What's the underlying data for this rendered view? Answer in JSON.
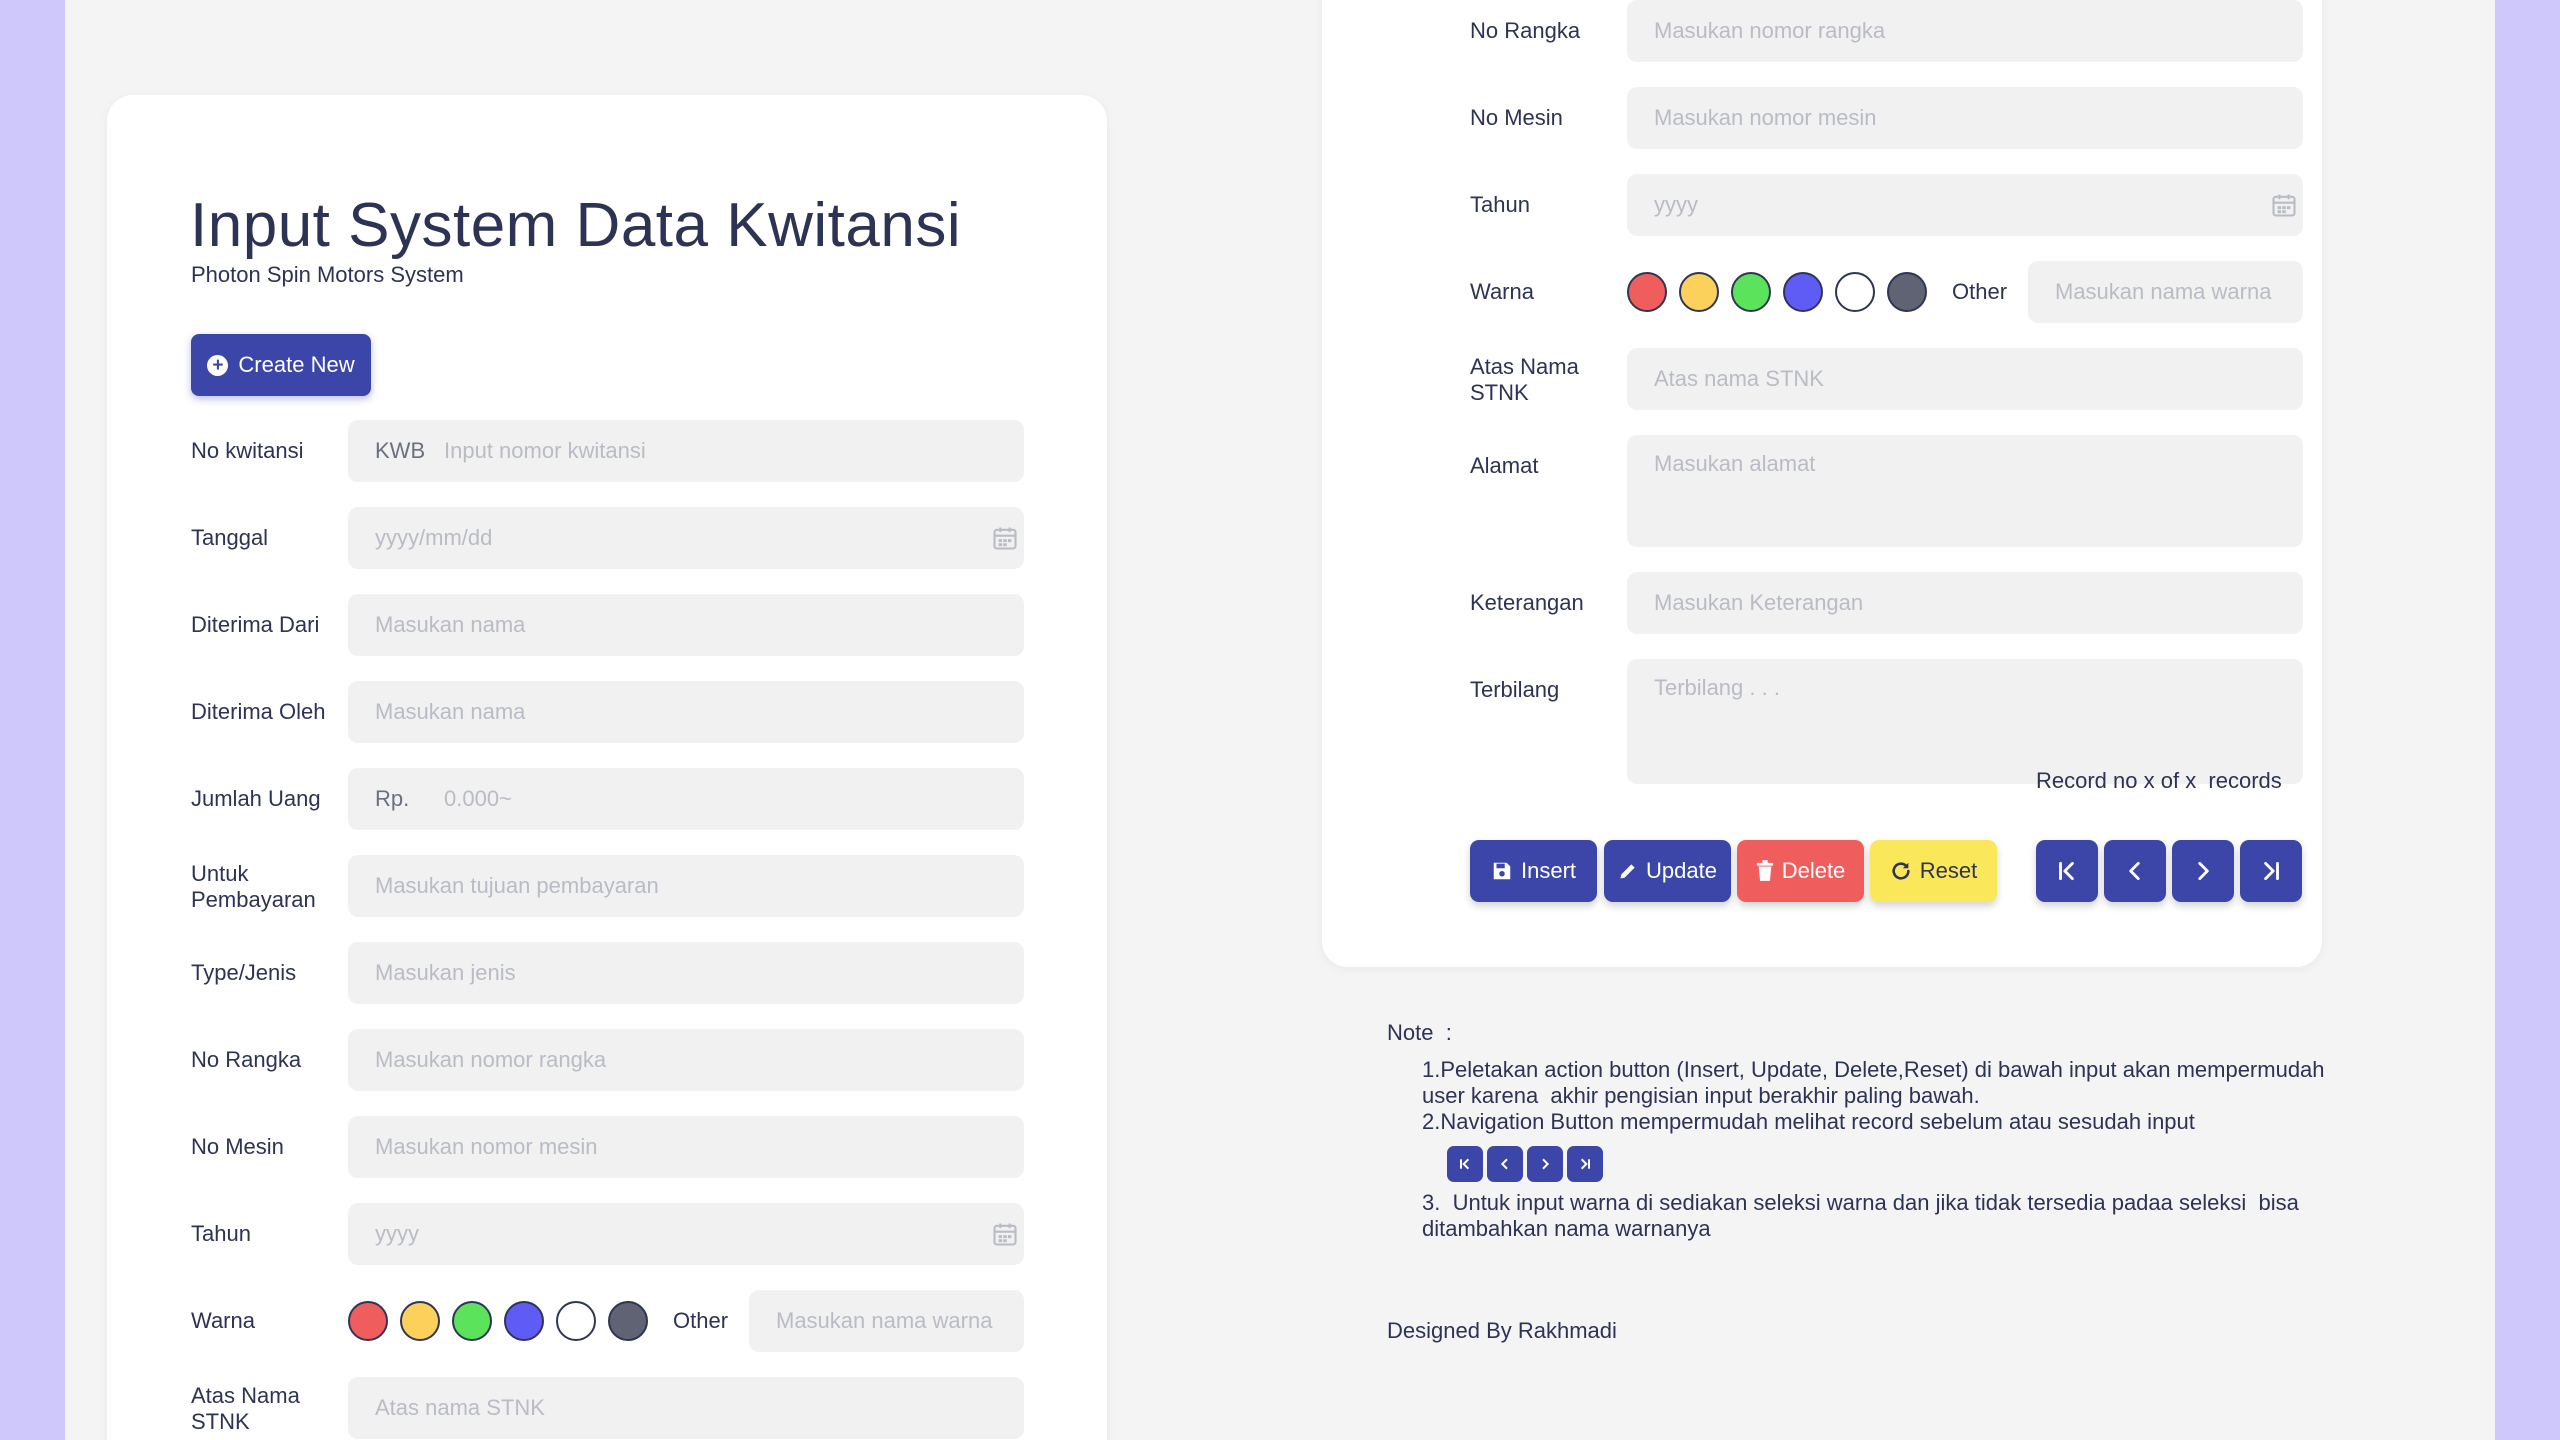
{
  "header": {
    "title": "Input System Data Kwitansi",
    "subtitle": "Photon Spin Motors System",
    "create_label": "Create New"
  },
  "left_form": {
    "no_kwitansi": {
      "label": "No kwitansi",
      "prefix": "KWB",
      "placeholder": "Input nomor kwitansi"
    },
    "tanggal": {
      "label": "Tanggal",
      "placeholder": "yyyy/mm/dd"
    },
    "diterima_dari": {
      "label": "Diterima Dari",
      "placeholder": "Masukan nama"
    },
    "diterima_oleh": {
      "label": "Diterima Oleh",
      "placeholder": "Masukan nama"
    },
    "jumlah_uang": {
      "label": "Jumlah Uang",
      "prefix": "Rp.",
      "placeholder": "0.000~"
    },
    "untuk_pembayaran": {
      "label": "Untuk\nPembayaran",
      "placeholder": "Masukan tujuan pembayaran"
    },
    "type_jenis": {
      "label": "Type/Jenis",
      "placeholder": "Masukan jenis"
    },
    "no_rangka": {
      "label": "No Rangka",
      "placeholder": "Masukan nomor rangka"
    },
    "no_mesin": {
      "label": "No Mesin",
      "placeholder": "Masukan nomor mesin"
    },
    "tahun": {
      "label": "Tahun",
      "placeholder": "yyyy"
    },
    "warna": {
      "label": "Warna",
      "other_label": "Other",
      "placeholder": "Masukan nama warna"
    },
    "atas_nama": {
      "label": "Atas Nama\nSTNK",
      "placeholder": "Atas nama STNK"
    }
  },
  "right_form": {
    "no_rangka": {
      "label": "No Rangka",
      "placeholder": "Masukan nomor rangka"
    },
    "no_mesin": {
      "label": "No Mesin",
      "placeholder": "Masukan nomor mesin"
    },
    "tahun": {
      "label": "Tahun",
      "placeholder": "yyyy"
    },
    "warna": {
      "label": "Warna",
      "other_label": "Other",
      "placeholder": "Masukan nama warna"
    },
    "atas_nama": {
      "label": "Atas Nama\nSTNK",
      "placeholder": "Atas nama STNK"
    },
    "alamat": {
      "label": "Alamat",
      "placeholder": "Masukan alamat"
    },
    "keterangan": {
      "label": "Keterangan",
      "placeholder": "Masukan Keterangan"
    },
    "terbilang": {
      "label": "Terbilang",
      "placeholder": "Terbilang . . ."
    }
  },
  "swatch_colors": [
    "#f05d5d",
    "#fbd15b",
    "#5be35b",
    "#5f5cf5",
    "#ffffff",
    "#5f6374"
  ],
  "actions": {
    "insert": "Insert",
    "update": "Update",
    "delete": "Delete",
    "reset": "Reset",
    "record_text": "Record no x of x  records"
  },
  "note": {
    "title": "Note  :",
    "line1": "1.Peletakan action button (Insert, Update, Delete,Reset) di bawah input akan mempermudah\nuser karena  akhir pengisian input berakhir paling bawah.",
    "line2": "2.Navigation Button mempermudah melihat record sebelum atau sesudah input",
    "line3": "3.  Untuk input warna di sediakan seleksi warna dan jika tidak tersedia padaa seleksi  bisa\nditambahkan nama warnanya"
  },
  "footer": {
    "designed_by": "Designed By Rakhmadi"
  },
  "colors": {
    "primary": "#3b46a8",
    "danger": "#f05d5d",
    "warning": "#fbe85a",
    "background": "#cfc8fb"
  }
}
